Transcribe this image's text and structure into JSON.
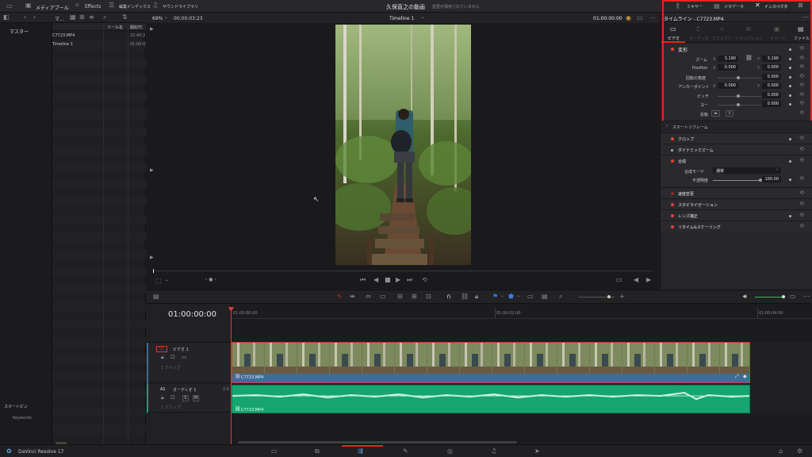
{
  "topbar": {
    "project_title": "久保直之の動画",
    "save_status": "変更が保存されていません",
    "media_pool": "メディアプール",
    "effects": "Effects",
    "edit_index": "編集インデックス",
    "sound_library": "サウンドライブラリ",
    "mixer": "ミキサー",
    "metadata": "メタデータ",
    "inspector": "インスペクタ"
  },
  "media": {
    "master_label": "マスター",
    "list_header_short": "マ...",
    "col_reel": "リール名",
    "col_start": "開始TC",
    "clips": [
      {
        "name": "C7723.MP4",
        "tc": "22:40:2"
      },
      {
        "name": "Timeline 1",
        "tc": "01:00:0"
      }
    ],
    "smart_bin": "スマートビン",
    "keywords": "Keywords"
  },
  "viewer": {
    "zoom": "69%",
    "timecode_left": "00:00:03:23",
    "timeline_name": "Timeline 1",
    "timecode_right": "01:00:00:00"
  },
  "inspector": {
    "title": "タイムライン - C7723.MP4",
    "tabs": [
      "ビデオ",
      "オーディオ",
      "エフェクト",
      "トランジション",
      "イメージ",
      "ファイル"
    ],
    "transform": {
      "label": "変形",
      "zoom_label": "ズーム",
      "zoom_x": "3.190",
      "zoom_y": "3.190",
      "position_label": "Position",
      "pos_x": "0.000",
      "pos_y": "0.000",
      "rotation_label": "回転の角度",
      "rotation": "0.000",
      "anchor_label": "アンカーポイント",
      "anchor_x": "0.000",
      "anchor_y": "0.000",
      "pitch_label": "ピッチ",
      "pitch": "0.000",
      "yaw_label": "ヨー",
      "yaw": "0.000",
      "flip_label": "反転"
    },
    "sections": {
      "smart_reframe": "スマートリフレーム",
      "crop": "クロップ",
      "dynamic_zoom": "ダイナミックズーム",
      "composite": "合成",
      "composite_mode_label": "合成モード",
      "composite_mode": "通常",
      "opacity_label": "不透明度",
      "opacity": "100.00",
      "speed_change": "速度変更",
      "stabilization": "スタビライゼーション",
      "lens_correction": "レンズ補正",
      "retime_scaling": "リタイム&スケーリング"
    },
    "x_axis": "X",
    "y_axis": "Y"
  },
  "timeline": {
    "current_tc": "01:00:00:00",
    "ruler_marks": [
      "01:00:00:00",
      "01:00:02:00",
      "01:00:04:00"
    ],
    "video_track_id": "V1",
    "video_track_name": "ビデオ 1",
    "video_track_count": "1 クリップ",
    "audio_track_id": "A1",
    "audio_track_name": "オーディオ 1",
    "audio_track_level": "2.0",
    "audio_track_count": "1 クリップ",
    "solo": "S",
    "mute": "M",
    "video_clip_name": "C7723.MP4",
    "audio_clip_name": "C7723.MP4"
  },
  "app": {
    "name": "DaVinci Resolve 17"
  },
  "colors": {
    "accent_red": "#e3271c",
    "audio_clip": "#16a571",
    "video_clip": "#3a6f98"
  }
}
